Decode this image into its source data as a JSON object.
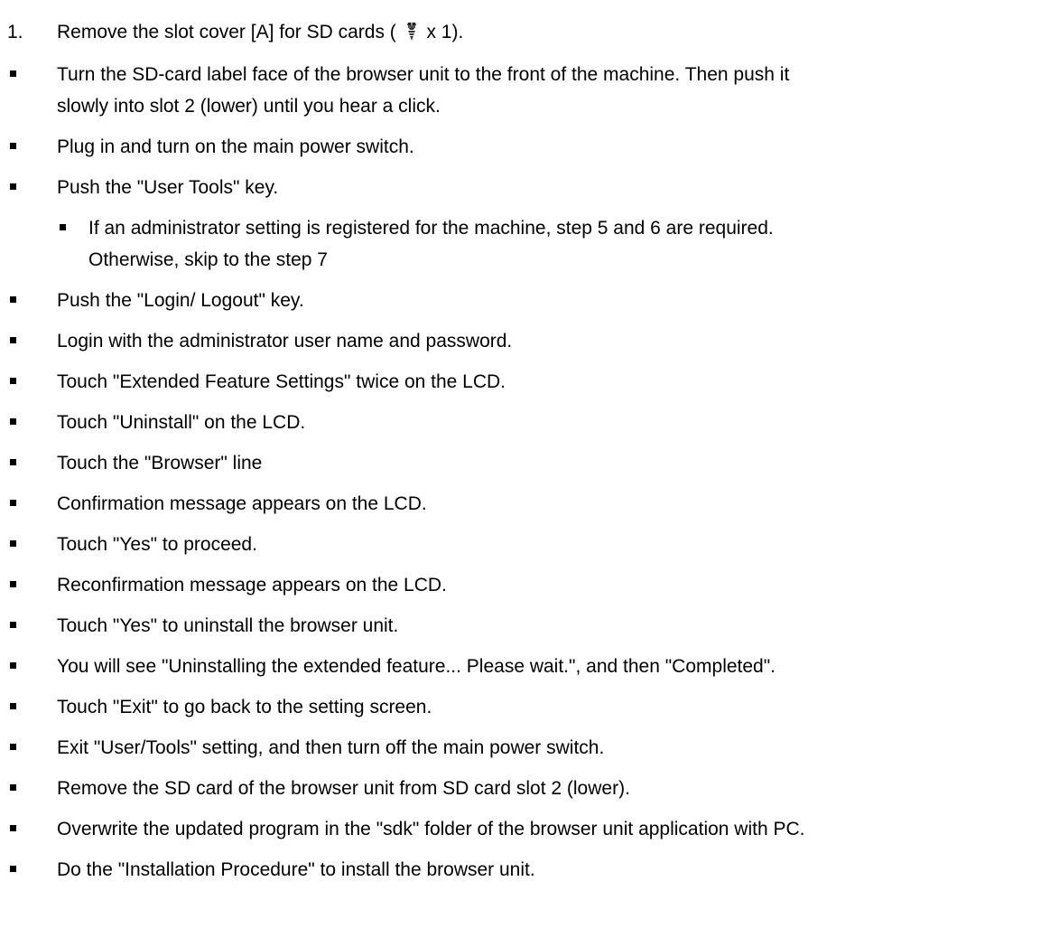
{
  "step1": {
    "number": "1.",
    "text_before": "Remove the slot cover [A] for SD cards ( ",
    "icon": "screw-icon",
    "text_after": " x 1)."
  },
  "steps": [
    {
      "level": 1,
      "lines": [
        "Turn the SD-card label face of the browser unit to the front of the machine. Then push it",
        "slowly into slot 2 (lower) until you hear a click."
      ]
    },
    {
      "level": 1,
      "lines": [
        "Plug in and turn on the main power switch."
      ]
    },
    {
      "level": 1,
      "lines": [
        "Push the \"User Tools\" key."
      ]
    },
    {
      "level": 2,
      "lines": [
        "If an administrator setting is registered for the machine, step 5 and 6 are required.",
        "Otherwise, skip to the step 7"
      ]
    },
    {
      "level": 1,
      "lines": [
        "Push the \"Login/ Logout\" key."
      ]
    },
    {
      "level": 1,
      "lines": [
        "Login with the administrator user name and password."
      ]
    },
    {
      "level": 1,
      "lines": [
        "Touch \"Extended Feature Settings\" twice on the LCD."
      ]
    },
    {
      "level": 1,
      "lines": [
        "Touch \"Uninstall\" on the LCD."
      ]
    },
    {
      "level": 1,
      "lines": [
        "Touch the \"Browser\" line"
      ]
    },
    {
      "level": 1,
      "lines": [
        "Confirmation message appears on the LCD."
      ]
    },
    {
      "level": 1,
      "lines": [
        "Touch \"Yes\" to proceed."
      ]
    },
    {
      "level": 1,
      "lines": [
        "Reconfirmation message appears on the LCD."
      ]
    },
    {
      "level": 1,
      "lines": [
        "Touch \"Yes\" to uninstall the browser unit."
      ]
    },
    {
      "level": 1,
      "lines": [
        "You will see \"Uninstalling the extended feature... Please wait.\", and then \"Completed\"."
      ]
    },
    {
      "level": 1,
      "lines": [
        "Touch \"Exit\" to go back to the setting screen."
      ]
    },
    {
      "level": 1,
      "lines": [
        "Exit \"User/Tools\" setting, and then turn off the main power switch."
      ]
    },
    {
      "level": 1,
      "lines": [
        "Remove the SD card of the browser unit from SD card slot 2 (lower)."
      ]
    },
    {
      "level": 1,
      "lines": [
        "Overwrite the updated program in the \"sdk\" folder of the browser unit application with PC."
      ]
    },
    {
      "level": 1,
      "lines": [
        "Do the \"Installation Procedure\" to install the browser unit."
      ]
    }
  ]
}
